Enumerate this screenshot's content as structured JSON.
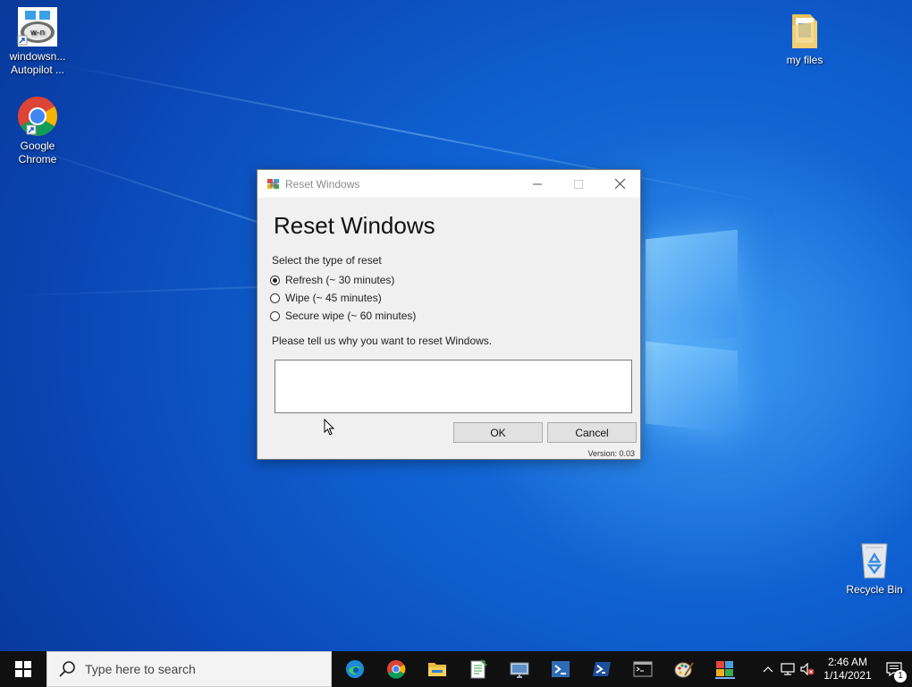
{
  "desktop": {
    "icons": [
      {
        "label_line1": "windowsn...",
        "label_line2": "Autopilot ..."
      },
      {
        "label_line1": "Google",
        "label_line2": "Chrome"
      },
      {
        "label_line1": "my files",
        "label_line2": ""
      },
      {
        "label_line1": "Recycle Bin",
        "label_line2": ""
      }
    ]
  },
  "dialog": {
    "window_title": "Reset Windows",
    "heading": "Reset Windows",
    "select_label": "Select the type of reset",
    "options": [
      {
        "label": "Refresh (~ 30 minutes)",
        "selected": true
      },
      {
        "label": "Wipe (~ 45 minutes)",
        "selected": false
      },
      {
        "label": "Secure wipe (~ 60 minutes)",
        "selected": false
      }
    ],
    "reason_label": "Please tell us why you want to reset Windows.",
    "reason_value": "",
    "ok_label": "OK",
    "cancel_label": "Cancel",
    "version": "Version: 0.03"
  },
  "taskbar": {
    "search_placeholder": "Type here to search",
    "clock_time": "2:46 AM",
    "clock_date": "1/14/2021",
    "notification_count": "1"
  },
  "colors": {
    "desktop_blue": "#0f5fd0",
    "taskbar": "#101010",
    "dialog_bg": "#f0f0f0",
    "button_bg": "#e1e1e1"
  }
}
